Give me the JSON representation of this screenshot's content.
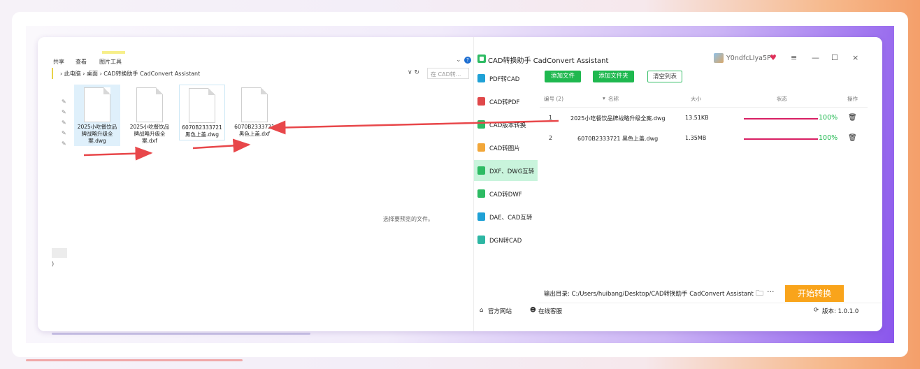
{
  "explorer": {
    "ribbon_tabs": [
      "共享",
      "查看",
      "图片工具"
    ],
    "address_path": "›  此电脑  ›  桌面  ›  CAD转换助手 CadConvert Assistant",
    "address_icons": "∨  ↻",
    "search_placeholder": "在 CAD转...",
    "files": [
      {
        "name": "2025小吃餐饮品牌战略升级全案.dwg"
      },
      {
        "name": "2025小吃餐饮品牌战略升级全案.dxf"
      },
      {
        "name": "6070B2333721 黑色上盖.dwg"
      },
      {
        "name": "6070B2333721 黑色上盖.dxf"
      }
    ],
    "preview_text": "选择要预览的文件。",
    "paren": ")"
  },
  "app": {
    "title": "CAD转换助手 CadConvert Assistant",
    "username": "Y0ndfcLIya5P",
    "sidebar": [
      {
        "label": "PDF转CAD",
        "color": "#1fa1d6"
      },
      {
        "label": "CAD转PDF",
        "color": "#e0484a"
      },
      {
        "label": "CAD版本转换",
        "color": "#2dbb63"
      },
      {
        "label": "CAD转图片",
        "color": "#f2a73a"
      },
      {
        "label": "DXF、DWG互转",
        "color": "#2dbb63",
        "active": true
      },
      {
        "label": "CAD转DWF",
        "color": "#2dbb63"
      },
      {
        "label": "DAE、CAD互转",
        "color": "#1fa1d6"
      },
      {
        "label": "DGN转CAD",
        "color": "#2db6a3"
      }
    ],
    "buttons": {
      "add_file": "添加文件",
      "add_folder": "添加文件夹",
      "clear": "清空列表"
    },
    "table": {
      "headers": {
        "index": "编号 (2)",
        "name": "名称",
        "size": "大小",
        "status": "状态",
        "action": "操作"
      },
      "rows": [
        {
          "index": "1",
          "name": "2025小吃餐饮品牌战略升级全案.dwg",
          "size": "13.51KB",
          "progress": 100,
          "pct": "100%"
        },
        {
          "index": "2",
          "name": "6070B2333721 黑色上盖.dwg",
          "size": "1.35MB",
          "progress": 100,
          "pct": "100%"
        }
      ]
    },
    "output_label": "输出目录: C:/Users/huibang/Desktop/CAD转换助手 CadConvert Assistant",
    "start_button": "开始转换",
    "footer": {
      "website": "官方网站",
      "service": "在线客服",
      "version": "版本: 1.0.1.0"
    }
  },
  "colors": {
    "accent_green": "#1fb84f",
    "progress": "#d81f63",
    "start": "#f9a41b",
    "arrow": "#e8474a"
  }
}
